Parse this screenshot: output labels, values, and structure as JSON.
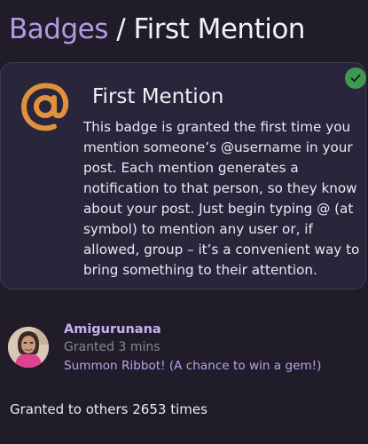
{
  "breadcrumb": {
    "parent": "Badges",
    "separator": "/",
    "current": "First Mention"
  },
  "badge": {
    "icon": "at-sign-icon",
    "title": "First Mention",
    "description": "This badge is granted the first time you mention someone’s @username in your post. Each mention generates a notification to that person, so they know about your post. Just begin typing @ (at symbol) to mention any user or, if allowed, group – it’s a convenient way to bring something to their attention.",
    "granted_icon": "check-icon",
    "icon_color": "#e0913e",
    "granted_color": "#3c9a55"
  },
  "grant": {
    "username": "Amigurunana",
    "time": "Granted 3 mins",
    "post_title": "Summon Ribbot! (A chance to win a gem!)"
  },
  "footer": {
    "granted_count_text": "Granted to others 2653 times"
  }
}
